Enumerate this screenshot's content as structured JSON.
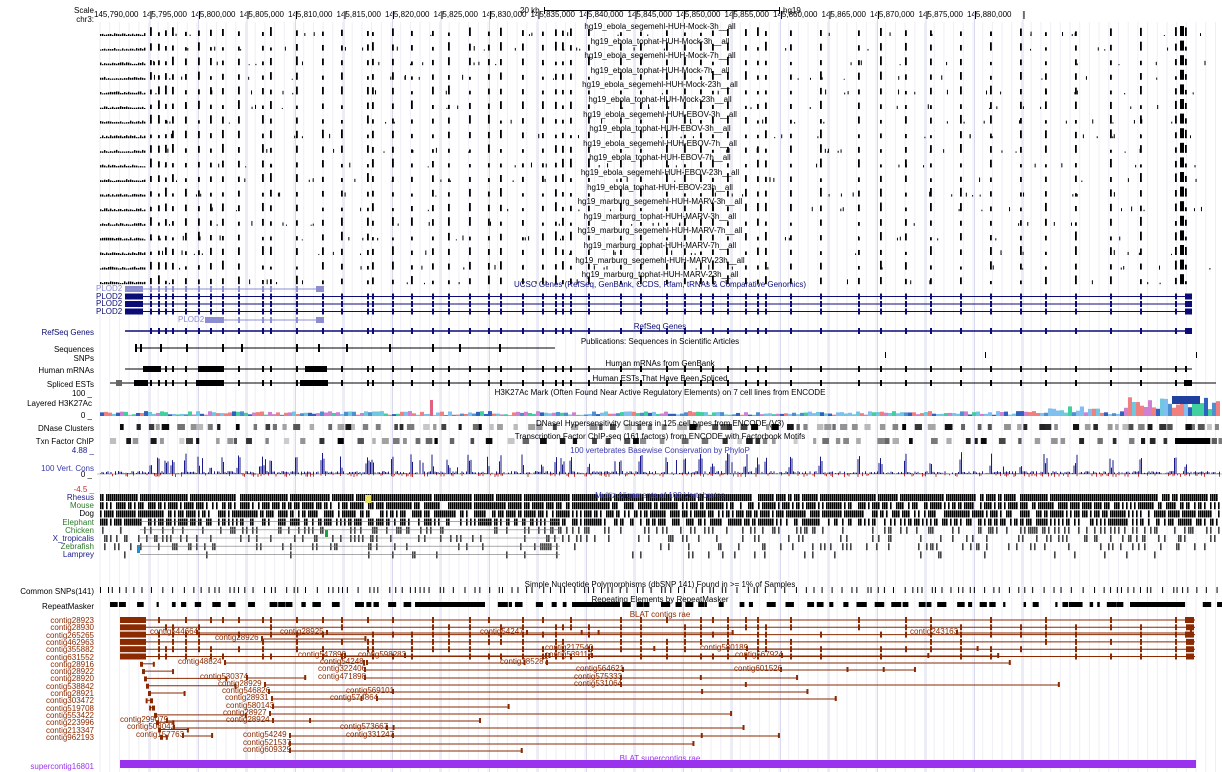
{
  "header": {
    "scale_label": "Scale",
    "chrom_label": "chr3:",
    "scale_bar": "20 kb",
    "assembly": "hg19"
  },
  "ruler": {
    "ticks": [
      "145,790,000",
      "145,795,000",
      "145,800,000",
      "145,805,000",
      "145,810,000",
      "145,815,000",
      "145,820,000",
      "145,825,000",
      "145,830,000",
      "145,835,000",
      "145,840,000",
      "145,845,000",
      "145,850,000",
      "145,855,000",
      "145,860,000",
      "145,865,000",
      "145,870,000",
      "145,875,000",
      "145,880,000"
    ]
  },
  "rnaseq_tracks": [
    "hg19_ebola_segemehl-HUH-Mock-3h__all",
    "hg19_ebola_tophat-HUH-Mock-3h__all",
    "hg19_ebola_segemehl-HUH-Mock-7h__all",
    "hg19_ebola_tophat-HUH-Mock-7h__all",
    "hg19_ebola_segemehl-HUH-Mock-23h__all",
    "hg19_ebola_tophat-HUH-Mock-23h__all",
    "hg19_ebola_segemehl-HUH-EBOV-3h__all",
    "hg19_ebola_tophat-HUH-EBOV-3h__all",
    "hg19_ebola_segemehl-HUH-EBOV-7h__all",
    "hg19_ebola_tophat-HUH-EBOV-7h__all",
    "hg19_ebola_segemehl-HUH-EBOV-23h__all",
    "hg19_ebola_tophat-HUH-EBOV-23h__all",
    "hg19_marburg_segemehl-HUH-MARV-3h__all",
    "hg19_marburg_tophat-HUH-MARV-3h__all",
    "hg19_marburg_segemehl-HUH-MARV-7h__all",
    "hg19_marburg_tophat-HUH-MARV-7h__all",
    "hg19_marburg_segemehl-HUH-MARV-23h__all",
    "hg19_marburg_tophat-HUH-MARV-23h__all"
  ],
  "ucsc_genes": {
    "title": "UCSC Genes (RefSeq, GenBank, CCDS, Rfam, tRNAs & Comparative Genomics)",
    "names": [
      "PLOD2",
      "PLOD2",
      "PLOD2",
      "PLOD2",
      "PLOD2"
    ]
  },
  "tracks": {
    "refseq": {
      "label": "RefSeq Genes",
      "title": "RefSeq Genes"
    },
    "sequences": {
      "label": "Sequences",
      "title": "Publications: Sequences in Scientific Articles"
    },
    "snps": {
      "label": "SNPs"
    },
    "mrna": {
      "label": "Human mRNAs",
      "title": "Human mRNAs from GenBank"
    },
    "est": {
      "label": "Spliced ESTs",
      "title": "Human ESTs That Have Been Spliced"
    },
    "h3k27ac": {
      "label": "Layered H3K27Ac",
      "title": "H3K27Ac Mark (Often Found Near Active Regulatory Elements) on 7 cell lines from ENCODE",
      "ymax": "100 _",
      "ymin": "0 _"
    },
    "dnase": {
      "label": "DNase Clusters",
      "title": "DNaseI Hypersensitivity Clusters in 125 cell types from ENCODE (V3)"
    },
    "txn": {
      "label": "Txn Factor ChIP",
      "title": "Transcription Factor ChIP-seq (161 factors) from ENCODE with Factorbook Motifs"
    },
    "cons": {
      "label": "100 Vert. Cons",
      "title": "100 vertebrates Basewise Conservation by PhyloP",
      "ymax": "4.88 _",
      "zero": "0 _",
      "ymin": "-4.5 _"
    },
    "multiz": {
      "title": "Multiz Alignments of 100 Vertebrates",
      "species": [
        "Rhesus",
        "Mouse",
        "Dog",
        "Elephant",
        "Chicken",
        "X_tropicalis",
        "Zebrafish",
        "Lamprey"
      ]
    },
    "common_snps": {
      "label": "Common SNPs(141)",
      "title": "Simple Nucleotide Polymorphisms (dbSNP 141) Found in >= 1% of Samples"
    },
    "repeatmasker": {
      "label": "RepeatMasker",
      "title": "Repeating Elements by RepeatMasker"
    },
    "blat": {
      "title": "BLAT contigs rae"
    },
    "supercontig": {
      "label": "supercontig16801",
      "title": "BLAT supercontigs rae"
    }
  },
  "contigs_left": [
    "contig28923",
    "contig28930",
    "contig265265",
    "contig462963",
    "contig355882",
    "contig631552",
    "contig28916",
    "contig28922",
    "contig28920",
    "contig538842",
    "contig28921",
    "contig303472",
    "contig519708",
    "contig553422",
    "contig223996",
    "contig213347",
    "contig962193"
  ],
  "contigs_inner": [
    {
      "name": "contig544664"
    },
    {
      "name": "contig28926"
    },
    {
      "name": "contig28925"
    },
    {
      "name": "contig54247"
    },
    {
      "name": "contig243163"
    },
    {
      "name": "contig217540"
    },
    {
      "name": "contig580189"
    },
    {
      "name": "contig539117"
    },
    {
      "name": "contig567924"
    },
    {
      "name": "contig547898"
    },
    {
      "name": "contig598283"
    },
    {
      "name": "contig48824"
    },
    {
      "name": "contig54248"
    },
    {
      "name": "contig385287"
    },
    {
      "name": "contig322406"
    },
    {
      "name": "contig564621"
    },
    {
      "name": "contig601526"
    },
    {
      "name": "contig530374"
    },
    {
      "name": "contig471898"
    },
    {
      "name": "contig575333"
    },
    {
      "name": "contig531064"
    },
    {
      "name": "contig28929"
    },
    {
      "name": "contig569101"
    },
    {
      "name": "contig546826"
    },
    {
      "name": "contig574864"
    },
    {
      "name": "contig28931"
    },
    {
      "name": "contig580143"
    },
    {
      "name": "contig28927"
    },
    {
      "name": "contig299079"
    },
    {
      "name": "contig28924"
    },
    {
      "name": "contig508042"
    },
    {
      "name": "contig573667"
    },
    {
      "name": "contig157763"
    },
    {
      "name": "contig331247"
    },
    {
      "name": "contig54249"
    },
    {
      "name": "contig521537"
    },
    {
      "name": "contig609329"
    }
  ],
  "colors": {
    "gene": "#0c0c78",
    "gene_light": "#8c8cd0",
    "cons": "#1a1a8a",
    "multiz_rhesus": "#1a1a8a",
    "multiz_mouse": "#2a6a2a",
    "multiz_other": "#2a6a2a",
    "contig": "#8b2a00",
    "supercontig": "#9933ee",
    "grid": "#d8d8ee"
  }
}
